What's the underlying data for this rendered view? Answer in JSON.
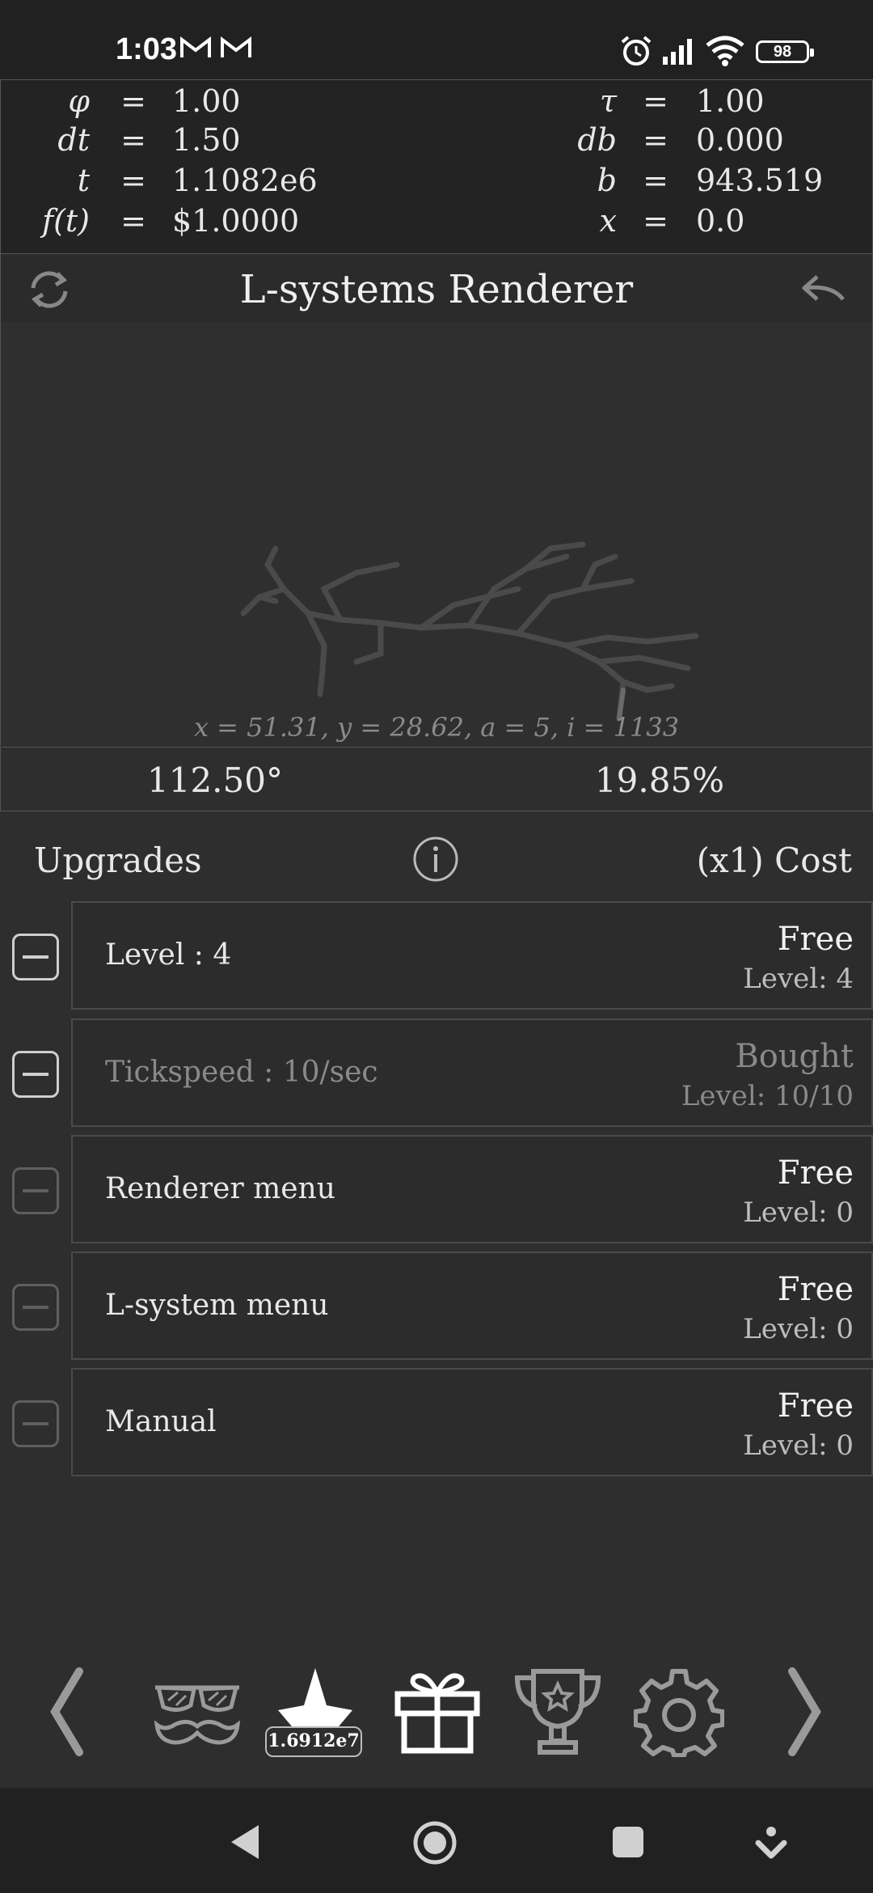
{
  "status": {
    "time": "1:03",
    "battery": "98"
  },
  "vars": {
    "left": [
      {
        "name": "φ",
        "value": "1.00"
      },
      {
        "name": "dt",
        "value": "1.50"
      },
      {
        "name": "t",
        "value": "1.1082e6"
      },
      {
        "name": "f(t)",
        "value": "$1.0000"
      }
    ],
    "right": [
      {
        "name": "τ",
        "value": "1.00"
      },
      {
        "name": "db",
        "value": "0.000"
      },
      {
        "name": "b",
        "value": "943.519"
      },
      {
        "name": "x",
        "value": "0.0"
      }
    ],
    "eq": "="
  },
  "header": {
    "title": "L-systems Renderer",
    "left_icon": "refresh-icon",
    "right_icon": "back-arrow-icon"
  },
  "renderer": {
    "coords": "x = 51.31,   y = 28.62,   a = 5,   i = 1133"
  },
  "stats": {
    "angle": "112.50°",
    "progress": "19.85%"
  },
  "upgrades": {
    "title": "Upgrades",
    "cost_label": "(x1) Cost",
    "items": [
      {
        "name": "Level : 4",
        "price": "Free",
        "level": "Level: 4"
      },
      {
        "name": "Tickspeed : 10/sec",
        "price": "Bought",
        "level": "Level: 10/10"
      },
      {
        "name": "Renderer menu",
        "price": "Free",
        "level": "Level: 0"
      },
      {
        "name": "L-system menu",
        "price": "Free",
        "level": "Level: 0"
      },
      {
        "name": "Manual",
        "price": "Free",
        "level": "Level: 0"
      }
    ]
  },
  "bottom_nav": {
    "tau_value": "1.6912e7"
  },
  "colors": {
    "background": "#2e2e2e",
    "panel": "#232323",
    "border": "#555555",
    "text": "#e8e8e8",
    "dim": "#8a8a8a"
  }
}
